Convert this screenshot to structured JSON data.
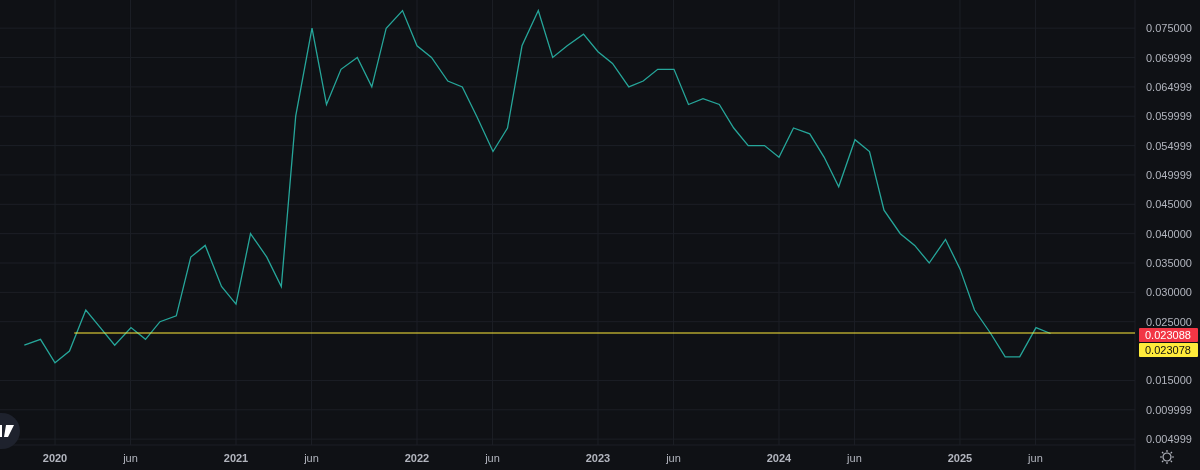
{
  "chart": {
    "chart_data": {
      "type": "line",
      "xlim": [
        2019.696,
        2025.967
      ],
      "ylim": [
        0.004,
        0.0798
      ],
      "xticks": [
        {
          "value": 2020,
          "label": "2020"
        },
        {
          "value": 2020.417,
          "label": "jun"
        },
        {
          "value": 2021,
          "label": "2021"
        },
        {
          "value": 2021.417,
          "label": "jun"
        },
        {
          "value": 2022,
          "label": "2022"
        },
        {
          "value": 2022.417,
          "label": "jun"
        },
        {
          "value": 2023,
          "label": "2023"
        },
        {
          "value": 2023.417,
          "label": "jun"
        },
        {
          "value": 2024,
          "label": "2024"
        },
        {
          "value": 2024.417,
          "label": "jun"
        },
        {
          "value": 2025,
          "label": "2025"
        },
        {
          "value": 2025.417,
          "label": "jun"
        }
      ],
      "grid": true,
      "yticks": [
        {
          "value": 0.075,
          "label": "0.075000"
        },
        {
          "value": 0.069999,
          "label": "0.069999"
        },
        {
          "value": 0.064999,
          "label": "0.064999"
        },
        {
          "value": 0.059999,
          "label": "0.059999"
        },
        {
          "value": 0.054999,
          "label": "0.054999"
        },
        {
          "value": 0.049999,
          "label": "0.049999"
        },
        {
          "value": 0.045,
          "label": "0.045000"
        },
        {
          "value": 0.04,
          "label": "0.040000"
        },
        {
          "value": 0.035,
          "label": "0.035000"
        },
        {
          "value": 0.03,
          "label": "0.030000"
        },
        {
          "value": 0.025,
          "label": "0.025000"
        },
        {
          "value": 0.015,
          "label": "0.015000"
        },
        {
          "value": 0.009999,
          "label": "0.009999"
        },
        {
          "value": 0.004999,
          "label": "0.004999"
        }
      ],
      "x": [
        2019.83,
        2019.92,
        2020.0,
        2020.08,
        2020.17,
        2020.25,
        2020.33,
        2020.42,
        2020.5,
        2020.58,
        2020.67,
        2020.75,
        2020.83,
        2020.92,
        2021.0,
        2021.08,
        2021.17,
        2021.25,
        2021.33,
        2021.42,
        2021.5,
        2021.58,
        2021.67,
        2021.75,
        2021.83,
        2021.92,
        2022.0,
        2022.08,
        2022.17,
        2022.25,
        2022.33,
        2022.42,
        2022.5,
        2022.58,
        2022.67,
        2022.75,
        2022.83,
        2022.92,
        2023.0,
        2023.08,
        2023.17,
        2023.25,
        2023.33,
        2023.42,
        2023.5,
        2023.58,
        2023.67,
        2023.75,
        2023.83,
        2023.92,
        2024.0,
        2024.08,
        2024.17,
        2024.25,
        2024.33,
        2024.42,
        2024.5,
        2024.58,
        2024.67,
        2024.75,
        2024.83,
        2024.92,
        2025.0,
        2025.08,
        2025.17,
        2025.25,
        2025.33,
        2025.42,
        2025.5
      ],
      "series": [
        {
          "color": "#26a69a",
          "values": [
            0.021,
            0.022,
            0.018,
            0.02,
            0.027,
            0.024,
            0.021,
            0.024,
            0.022,
            0.025,
            0.026,
            0.036,
            0.038,
            0.031,
            0.028,
            0.04,
            0.036,
            0.031,
            0.06,
            0.075,
            0.062,
            0.068,
            0.07,
            0.065,
            0.075,
            0.078,
            0.072,
            0.07,
            0.066,
            0.065,
            0.06,
            0.054,
            0.058,
            0.072,
            0.078,
            0.07,
            0.072,
            0.074,
            0.071,
            0.069,
            0.065,
            0.066,
            0.068,
            0.068,
            0.062,
            0.063,
            0.062,
            0.058,
            0.055,
            0.055,
            0.053,
            0.058,
            0.057,
            0.053,
            0.048,
            0.056,
            0.054,
            0.044,
            0.04,
            0.038,
            0.035,
            0.039,
            0.034,
            0.027,
            0.023,
            0.019,
            0.019,
            0.024,
            0.023
          ]
        }
      ],
      "ref_lines": [
        {
          "axis": "y",
          "value": 0.023078,
          "label": "0.023078",
          "color": "#ffeb3b"
        }
      ]
    },
    "last_price": {
      "label": "0.023088",
      "color": "#f23645"
    }
  }
}
